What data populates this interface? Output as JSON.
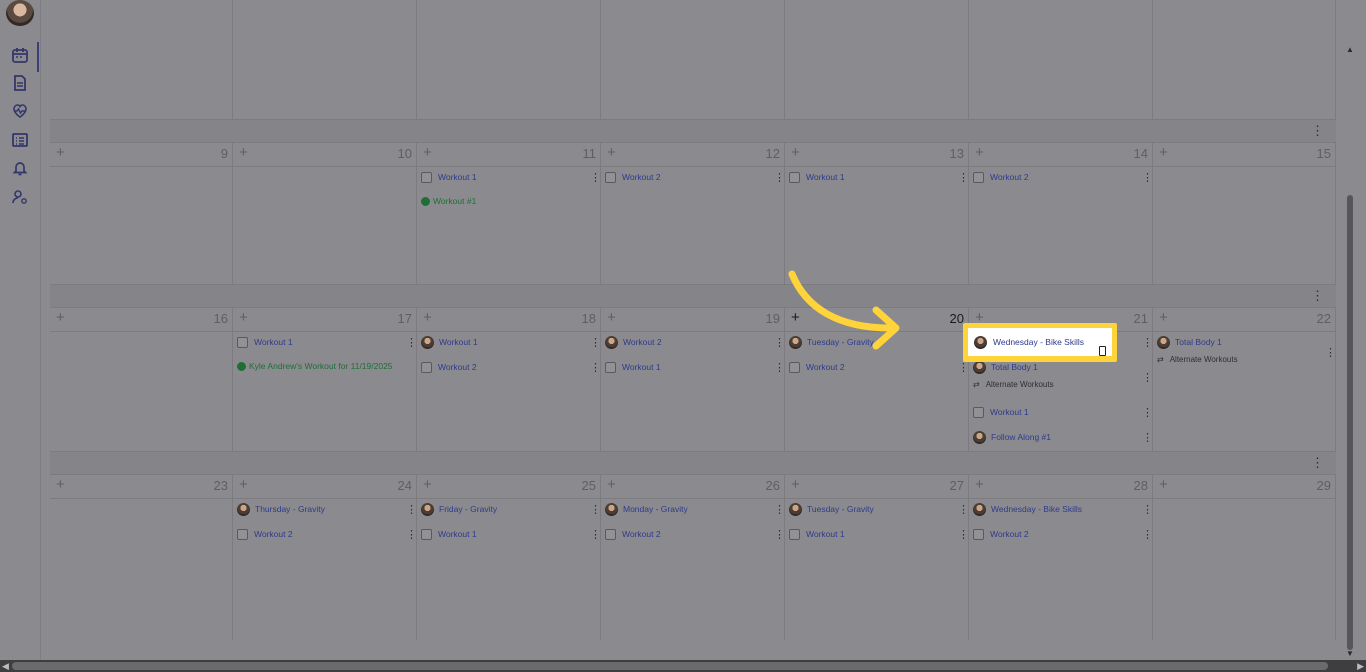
{
  "sidebar": {
    "icons": [
      "calendar-icon",
      "document-icon",
      "heart-pulse-icon",
      "list-icon",
      "bell-icon",
      "user-settings-icon"
    ]
  },
  "calendar": {
    "week1": {
      "days": [
        "",
        "",
        "",
        "",
        "",
        "",
        ""
      ]
    },
    "week2": {
      "days": [
        "9",
        "10",
        "11",
        "12",
        "13",
        "14",
        "15"
      ]
    },
    "week3": {
      "days": [
        "16",
        "17",
        "18",
        "19",
        "20",
        "21",
        "22"
      ]
    },
    "week4": {
      "days": [
        "23",
        "24",
        "25",
        "26",
        "27",
        "28",
        "29"
      ]
    },
    "entries": {
      "w2": {
        "d11": [
          {
            "type": "check",
            "text": "Workout 1"
          },
          {
            "type": "done",
            "text": "Workout #1"
          }
        ],
        "d12": [
          {
            "type": "check",
            "text": "Workout 2"
          }
        ],
        "d13": [
          {
            "type": "check",
            "text": "Workout 1"
          }
        ],
        "d14": [
          {
            "type": "check",
            "text": "Workout 2"
          }
        ]
      },
      "w3": {
        "d17": [
          {
            "type": "check",
            "text": "Workout 1"
          },
          {
            "type": "done",
            "text": "Kyle Andrew's Workout for 11/19/2025"
          }
        ],
        "d18": [
          {
            "type": "avatar",
            "text": "Workout 1"
          },
          {
            "type": "check",
            "text": "Workout 2"
          }
        ],
        "d19": [
          {
            "type": "avatar",
            "text": "Workout 2"
          },
          {
            "type": "check",
            "text": "Workout 1"
          }
        ],
        "d20": [
          {
            "type": "avatar",
            "text": "Tuesday - Gravity"
          },
          {
            "type": "check",
            "text": "Workout 2"
          }
        ],
        "d21": [
          {
            "type": "avatar",
            "text": "Wednesday - Bike Skills"
          },
          {
            "type": "avatar",
            "text": "Total Body 1"
          },
          {
            "type": "alt",
            "text": "Alternate Workouts"
          },
          {
            "type": "check",
            "text": "Workout 1"
          },
          {
            "type": "avatar",
            "text": "Follow Along #1"
          }
        ],
        "d22": [
          {
            "type": "avatar",
            "text": "Total Body 1"
          },
          {
            "type": "alt",
            "text": "Alternate Workouts"
          }
        ]
      },
      "w4": {
        "d24": [
          {
            "type": "avatar",
            "text": "Thursday - Gravity"
          },
          {
            "type": "check",
            "text": "Workout 2"
          }
        ],
        "d25": [
          {
            "type": "avatar",
            "text": "Friday - Gravity"
          },
          {
            "type": "check",
            "text": "Workout 1"
          }
        ],
        "d26": [
          {
            "type": "avatar",
            "text": "Monday - Gravity"
          },
          {
            "type": "check",
            "text": "Workout 2"
          }
        ],
        "d27": [
          {
            "type": "avatar",
            "text": "Tuesday - Gravity"
          },
          {
            "type": "check",
            "text": "Workout 1"
          }
        ],
        "d28": [
          {
            "type": "avatar",
            "text": "Wednesday - Bike Skills"
          },
          {
            "type": "check",
            "text": "Workout 2"
          }
        ]
      }
    },
    "highlight": {
      "text": "Wednesday - Bike Skills"
    }
  },
  "colors": {
    "accent": "#ffd43b",
    "link": "#2e3a8c",
    "done": "#1f6e36"
  }
}
